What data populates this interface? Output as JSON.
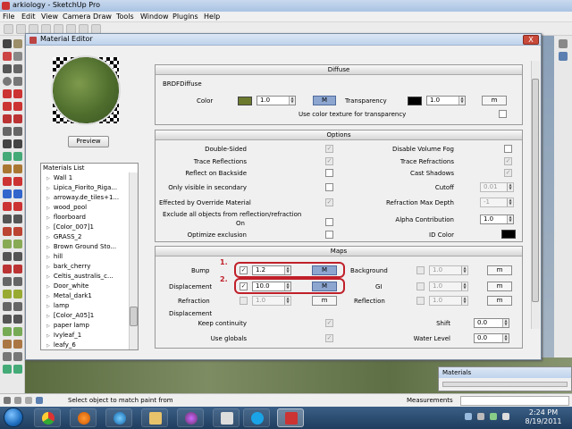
{
  "app": {
    "title": "arkiology - SketchUp Pro"
  },
  "menu": [
    "File",
    "Edit",
    "View",
    "Camera",
    "Draw",
    "Tools",
    "Window",
    "Plugins",
    "Help"
  ],
  "dialog": {
    "title": "Material Editor",
    "close_label": "X"
  },
  "preview": {
    "button_label": "Preview"
  },
  "materials_list": {
    "header": "Materials List",
    "items": [
      "Wall 1",
      "Lipica_Fiorito_Riga...",
      "arroway.de_tiles+1...",
      "wood_pool",
      "floorboard",
      "[Color_007]1",
      "GRASS_2",
      "Brown Ground Sto...",
      "hill",
      "bark_cherry",
      "Celtis_australis_c...",
      "Door_white",
      "Metal_dark1",
      "lamp",
      "[Color_A05]1",
      "paper lamp",
      "Ivyleaf_1",
      "leafy_6"
    ]
  },
  "diffuse": {
    "header": "Diffuse",
    "sublabel": "BRDFDiffuse",
    "color_label": "Color",
    "color_swatch": "#6b7a2e",
    "color_value": "1.0",
    "m_label": "M",
    "transparency_label": "Transparency",
    "transparency_swatch": "#000000",
    "transparency_value": "1.0",
    "transparency_m_label": "m",
    "use_texture_label": "Use color texture for transparency"
  },
  "options": {
    "header": "Options",
    "left": [
      {
        "label": "Double-Sided",
        "checked": "✓"
      },
      {
        "label": "Trace Reflections",
        "checked": "✓"
      },
      {
        "label": "Reflect on Backside",
        "checked": ""
      },
      {
        "label": "Only visible in secondary",
        "checked": ""
      },
      {
        "label": "Effected by Override Material",
        "checked": "✓"
      },
      {
        "label": "Exclude all objects from reflection/refraction",
        "checked": ""
      },
      {
        "label": "On",
        "checked": ""
      },
      {
        "label": "Optimize exclusion",
        "checked": ""
      }
    ],
    "right": [
      {
        "label": "Disable Volume Fog"
      },
      {
        "label": "Trace Refractions"
      },
      {
        "label": "Cast Shadows"
      },
      {
        "label": "Cutoff",
        "value": "0.01"
      },
      {
        "label": "Refraction Max Depth",
        "value": "-1"
      },
      {
        "label": "Alpha Contribution",
        "value": "1.0"
      },
      {
        "label": "ID Color",
        "swatch": "#000000"
      }
    ]
  },
  "maps": {
    "header": "Maps",
    "bump_label": "Bump",
    "bump_value": "1.2",
    "displacement_label": "Displacement",
    "displacement_value": "10.0",
    "refraction_label": "Refraction",
    "refraction_value": "1.0",
    "background_label": "Background",
    "background_value": "1.0",
    "gi_label": "GI",
    "gi_value": "1.0",
    "reflection_label": "Reflection",
    "reflection_value": "1.0",
    "m_upper": "M",
    "m_lower": "m",
    "displacement_section_label": "Displacement",
    "keep_continuity_label": "Keep continuity",
    "use_globals_label": "Use globals",
    "shift_label": "Shift",
    "shift_value": "0.0",
    "water_level_label": "Water Level",
    "water_level_value": "0.0",
    "annotation_1": "1.",
    "annotation_2": "2."
  },
  "materials_panel": {
    "title": "Materials"
  },
  "status": {
    "message": "Select object to match paint from",
    "measurements": "Measurements"
  },
  "taskbar": {
    "time": "2:24 PM",
    "date": "8/19/2011"
  },
  "colors": {
    "accent": "#8ca6d0",
    "annotation": "#c0202a"
  }
}
